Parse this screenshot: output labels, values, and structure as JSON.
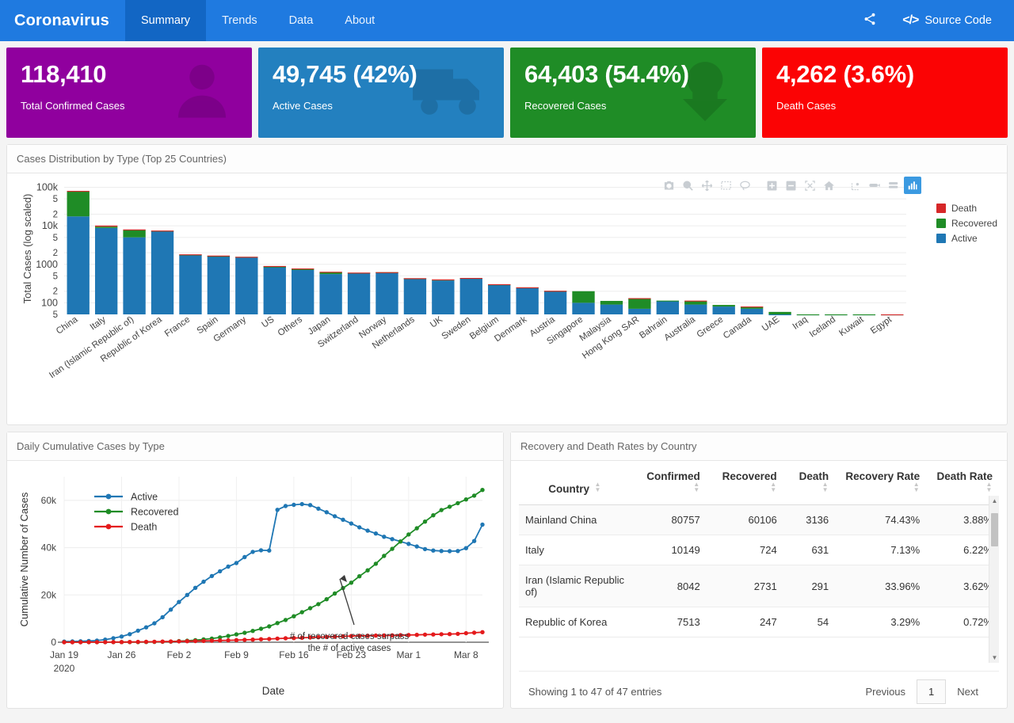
{
  "navbar": {
    "brand": "Coronavirus",
    "links": [
      {
        "label": "Summary",
        "active": true
      },
      {
        "label": "Trends",
        "active": false
      },
      {
        "label": "Data",
        "active": false
      },
      {
        "label": "About",
        "active": false
      }
    ],
    "share_icon": "share-icon",
    "source_code_label": "Source Code",
    "source_code_icon": "code-icon",
    "bg_color": "#1f7ae0",
    "active_bg_color": "#1266c4"
  },
  "cards": [
    {
      "value": "118,410",
      "label": "Total Confirmed Cases",
      "color": "#90009e",
      "icon": "user-icon"
    },
    {
      "value": "49,745 (42%)",
      "label": "Active Cases",
      "color": "#2380bf",
      "icon": "ambulance-icon"
    },
    {
      "value": "64,403 (54.4%)",
      "label": "Recovered Cases",
      "color": "#1f8c26",
      "icon": "download-arrow-icon"
    },
    {
      "value": "4,262 (3.6%)",
      "label": "Death Cases",
      "color": "#fb0304",
      "icon": "none"
    }
  ],
  "bar_panel": {
    "title": "Cases Distribution by Type (Top 25 Countries)",
    "modebar": [
      {
        "name": "download-plot-png-icon",
        "glyph": "camera"
      },
      {
        "name": "zoom-icon",
        "glyph": "zoom"
      },
      {
        "name": "pan-icon",
        "glyph": "pan"
      },
      {
        "name": "box-select-icon",
        "glyph": "box"
      },
      {
        "name": "lasso-select-icon",
        "glyph": "lasso"
      },
      {
        "name": "zoom-in-icon",
        "glyph": "plus"
      },
      {
        "name": "zoom-out-icon",
        "glyph": "minus"
      },
      {
        "name": "autoscale-icon",
        "glyph": "autoscale"
      },
      {
        "name": "reset-axes-icon",
        "glyph": "home"
      },
      {
        "name": "toggle-spike-lines-icon",
        "glyph": "spike"
      },
      {
        "name": "hover-compare-icon",
        "glyph": "hover1"
      },
      {
        "name": "hover-closest-icon",
        "glyph": "hover2"
      },
      {
        "name": "plotly-logo-icon",
        "glyph": "logo"
      }
    ],
    "legend": [
      {
        "label": "Death",
        "color": "#d62728"
      },
      {
        "label": "Recovered",
        "color": "#1f8c26"
      },
      {
        "label": "Active",
        "color": "#1f77b4"
      }
    ]
  },
  "line_panel": {
    "title": "Daily Cumulative Cases by Type",
    "annotation_line_1": "# of recovered cases surpass",
    "annotation_line_2": "the # of active cases"
  },
  "table_panel": {
    "title": "Recovery and Death Rates by Country",
    "columns": [
      "Country",
      "Confirmed",
      "Recovered",
      "Death",
      "Recovery Rate",
      "Death Rate"
    ],
    "rows": [
      {
        "country": "Mainland China",
        "confirmed": "80757",
        "recovered": "60106",
        "death": "3136",
        "recovery_rate": "74.43%",
        "death_rate": "3.88%"
      },
      {
        "country": "Italy",
        "confirmed": "10149",
        "recovered": "724",
        "death": "631",
        "recovery_rate": "7.13%",
        "death_rate": "6.22%"
      },
      {
        "country": "Iran (Islamic Republic of)",
        "confirmed": "8042",
        "recovered": "2731",
        "death": "291",
        "recovery_rate": "33.96%",
        "death_rate": "3.62%"
      },
      {
        "country": "Republic of Korea",
        "confirmed": "7513",
        "recovered": "247",
        "death": "54",
        "recovery_rate": "3.29%",
        "death_rate": "0.72%"
      }
    ],
    "info": "Showing 1 to 47 of 47 entries",
    "previous_label": "Previous",
    "page_label": "1",
    "next_label": "Next"
  },
  "chart_data": [
    {
      "type": "bar",
      "id": "cases-distribution-bar",
      "title": "Cases Distribution by Type (Top 25 Countries)",
      "xlabel": "",
      "ylabel": "Total Cases (log scaled)",
      "yscale": "log",
      "ylim": [
        50,
        130000
      ],
      "ytick_labels": [
        "100k",
        "5",
        "2",
        "10k",
        "5",
        "2",
        "1000",
        "5",
        "2",
        "100",
        "5"
      ],
      "ytick_values": [
        100000,
        50000,
        20000,
        10000,
        5000,
        2000,
        1000,
        500,
        200,
        100,
        50
      ],
      "grid": true,
      "barmode": "stack",
      "legend_position": "top-right",
      "categories": [
        "China",
        "Italy",
        "Iran (Islamic Republic of)",
        "Republic of Korea",
        "France",
        "Spain",
        "Germany",
        "US",
        "Others",
        "Japan",
        "Switzerland",
        "Norway",
        "Netherlands",
        "UK",
        "Sweden",
        "Belgium",
        "Denmark",
        "Austria",
        "Singapore",
        "Malaysia",
        "Hong Kong SAR",
        "Bahrain",
        "Australia",
        "Greece",
        "Canada",
        "UAE",
        "Iraq",
        "Iceland",
        "Kuwait",
        "Egypt"
      ],
      "series": [
        {
          "name": "Active",
          "color": "#1f77b4",
          "values": [
            17560,
            8794,
            5020,
            7212,
            1774,
            1620,
            1545,
            867,
            710,
            557,
            600,
            620,
            430,
            380,
            440,
            300,
            250,
            200,
            100,
            90,
            70,
            110,
            90,
            80,
            70,
            40,
            45,
            40,
            45,
            30
          ]
        },
        {
          "name": "Recovered",
          "color": "#1f8c26",
          "values": [
            60106,
            724,
            2731,
            247,
            12,
            30,
            18,
            8,
            60,
            76,
            4,
            1,
            2,
            19,
            1,
            1,
            1,
            4,
            100,
            22,
            60,
            4,
            21,
            8,
            9,
            18,
            5,
            1,
            1,
            1
          ]
        },
        {
          "name": "Death",
          "color": "#d62728",
          "values": [
            3136,
            631,
            291,
            54,
            30,
            35,
            2,
            28,
            8,
            6,
            4,
            3,
            4,
            6,
            1,
            3,
            1,
            1,
            0,
            0,
            2,
            0,
            3,
            0,
            1,
            0,
            0,
            0,
            0,
            1
          ]
        }
      ]
    },
    {
      "type": "line",
      "id": "daily-cumulative-cases-line",
      "title": "Daily Cumulative Cases by Type",
      "xlabel": "Date",
      "ylabel": "Cumulative Number of Cases",
      "ylim": [
        0,
        70000
      ],
      "ytick_labels": [
        "0",
        "20k",
        "40k",
        "60k"
      ],
      "ytick_values": [
        0,
        20000,
        40000,
        60000
      ],
      "xtick_labels": [
        "Jan 19\n2020",
        "Jan 26",
        "Feb 2",
        "Feb 9",
        "Feb 16",
        "Feb 23",
        "Mar 1",
        "Mar 8"
      ],
      "grid": true,
      "legend_position": "inside-top-left",
      "annotation": "# of recovered cases surpass the # of active cases",
      "x": [
        "Jan 19",
        "Jan 20",
        "Jan 21",
        "Jan 22",
        "Jan 23",
        "Jan 24",
        "Jan 25",
        "Jan 26",
        "Jan 27",
        "Jan 28",
        "Jan 29",
        "Jan 30",
        "Jan 31",
        "Feb 1",
        "Feb 2",
        "Feb 3",
        "Feb 4",
        "Feb 5",
        "Feb 6",
        "Feb 7",
        "Feb 8",
        "Feb 9",
        "Feb 10",
        "Feb 11",
        "Feb 12",
        "Feb 13",
        "Feb 14",
        "Feb 15",
        "Feb 16",
        "Feb 17",
        "Feb 18",
        "Feb 19",
        "Feb 20",
        "Feb 21",
        "Feb 22",
        "Feb 23",
        "Feb 24",
        "Feb 25",
        "Feb 26",
        "Feb 27",
        "Feb 28",
        "Feb 29",
        "Mar 1",
        "Mar 2",
        "Mar 3",
        "Mar 4",
        "Mar 5",
        "Mar 6",
        "Mar 7",
        "Mar 8",
        "Mar 9",
        "Mar 10"
      ],
      "series": [
        {
          "name": "Active",
          "color": "#1f77b4",
          "values": [
            280,
            320,
            400,
            520,
            720,
            1100,
            1700,
            2400,
            3400,
            4900,
            6300,
            8000,
            10600,
            13800,
            17000,
            20000,
            23000,
            25600,
            28000,
            30000,
            32000,
            33500,
            36000,
            38200,
            38900,
            38800,
            56000,
            57600,
            58100,
            58400,
            58000,
            56500,
            55000,
            53300,
            51800,
            50200,
            48600,
            47200,
            46000,
            44600,
            43600,
            42600,
            41600,
            40500,
            39400,
            38800,
            38600,
            38500,
            38600,
            39800,
            42800,
            49745
          ]
        },
        {
          "name": "Recovered",
          "color": "#1f8c26",
          "values": [
            25,
            30,
            32,
            35,
            38,
            42,
            48,
            55,
            62,
            70,
            110,
            135,
            200,
            280,
            480,
            640,
            880,
            1200,
            1550,
            2050,
            2650,
            3300,
            4000,
            4800,
            5700,
            6700,
            8100,
            9400,
            11000,
            12700,
            14400,
            16100,
            18200,
            20600,
            22900,
            25200,
            27900,
            30400,
            33200,
            36500,
            39500,
            42600,
            45600,
            48200,
            51000,
            53700,
            55900,
            57300,
            58800,
            60400,
            62000,
            64403
          ]
        },
        {
          "name": "Death",
          "color": "#e41a1c",
          "values": [
            6,
            9,
            15,
            17,
            25,
            41,
            56,
            80,
            106,
            132,
            170,
            213,
            259,
            304,
            362,
            426,
            492,
            565,
            638,
            724,
            813,
            910,
            1012,
            1115,
            1261,
            1383,
            1526,
            1669,
            1775,
            1873,
            2009,
            2126,
            2247,
            2360,
            2462,
            2618,
            2699,
            2763,
            2800,
            2858,
            2923,
            2977,
            3050,
            3117,
            3202,
            3285,
            3380,
            3460,
            3558,
            3802,
            4012,
            4262
          ]
        }
      ]
    }
  ]
}
